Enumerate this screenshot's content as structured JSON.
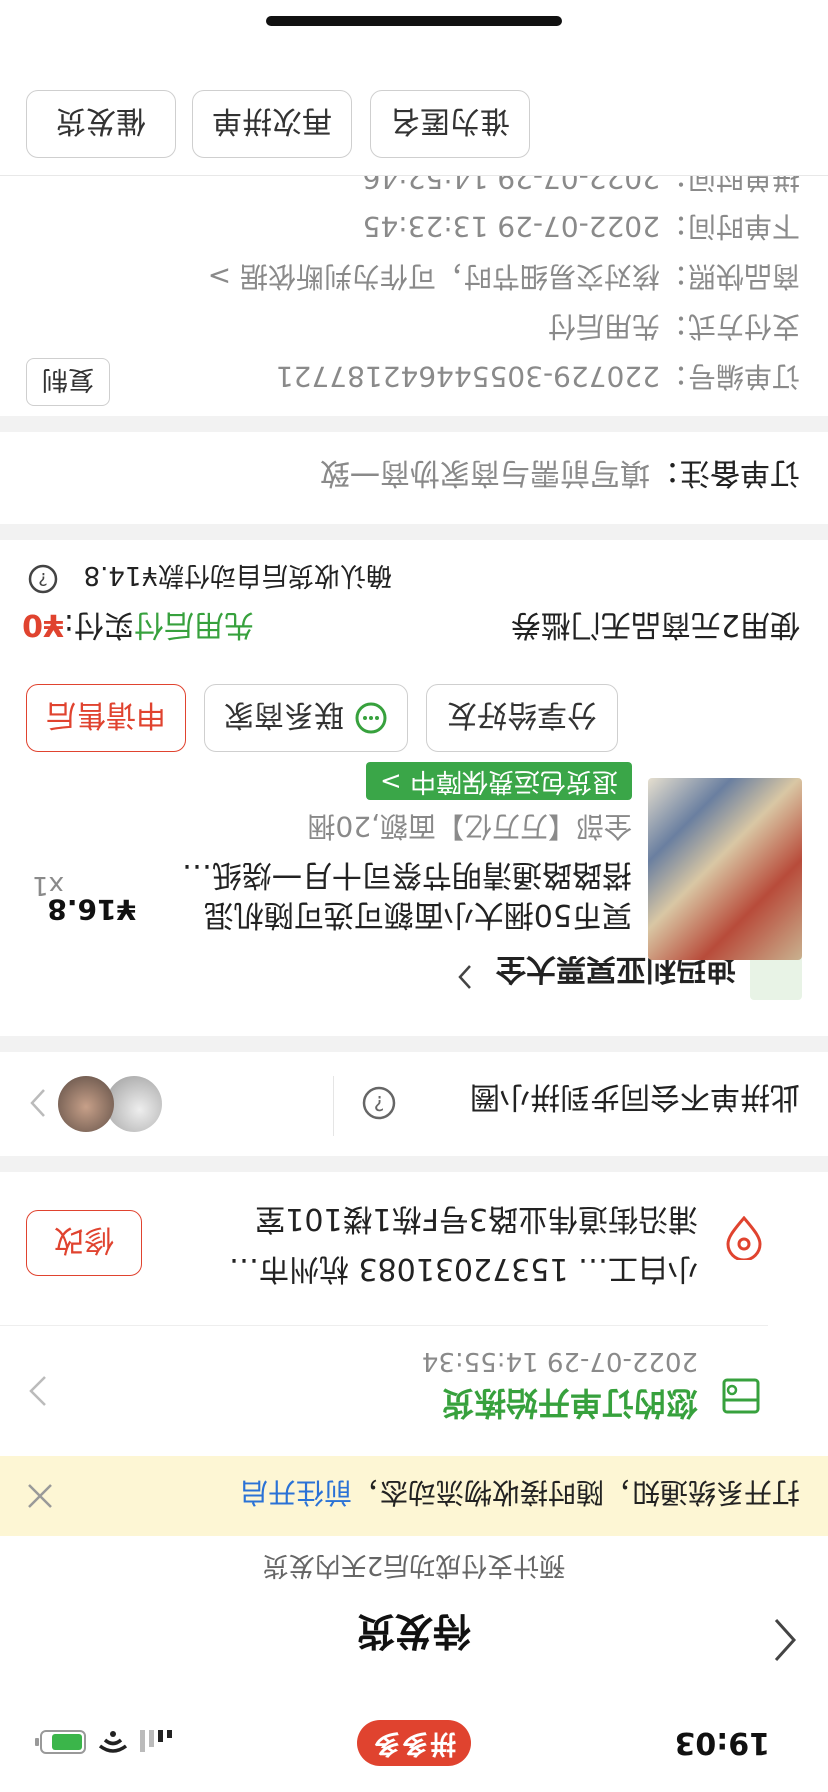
{
  "status_bar": {
    "time": "19:03",
    "brand": "拼多多"
  },
  "header": {
    "title": "待发货",
    "subtitle": "预计支付成功后2天内发货"
  },
  "notice": {
    "text": "打开系统通知，随时接收物流动态，",
    "link": "前往开启"
  },
  "logistics": {
    "status": "您的订单开始拣货",
    "time": "2022-07-29 14:55:34"
  },
  "address": {
    "line1": "小白工…    15372031083  杭州市…",
    "line2": "浦沿街道伟业路3号F栋1楼101室",
    "edit_label": "修改"
  },
  "group": {
    "text": "此拼单不会同步到拼小圈"
  },
  "shop": {
    "name": "迪玛利亚冥票大全",
    "logo_text": "迪玛利亚冥票大全"
  },
  "product": {
    "title": "冥币50捆大小面额可选可随机混搭路路通清明节祭司十月一烧纸…",
    "spec": "全部【万万亿】面额,20捆",
    "price": "¥16.8",
    "qty": "x1",
    "guarantee": "退货包运费保障中 >"
  },
  "actions": {
    "share": "分享给好友",
    "contact": "联系商家",
    "after_sale": "申请售后"
  },
  "payment": {
    "coupon_label": "使用2元商品无门槛券",
    "pay_later": "先用后付",
    "paid_label": "实付:",
    "paid_amount": "¥0",
    "note": "确认收货后自动付款¥14.8"
  },
  "remark": {
    "label": "订单备注：",
    "value": "填写前需与商家协商一致"
  },
  "order_info": {
    "rows": [
      {
        "label": "订单编号：",
        "value": "220729-305544642187721"
      },
      {
        "label": "支付方式：",
        "value": "先用后付"
      },
      {
        "label": "商品快照：",
        "value": "核对交易细节时，可作为判断依据 >"
      },
      {
        "label": "下单时间：",
        "value": "2022-07-29 13:23:45"
      },
      {
        "label": "拼单时间：",
        "value": "2022-07-29 14:52:46"
      }
    ],
    "copy_label": "复制"
  },
  "bottom_buttons": {
    "pay_for_me": "谁为匿名",
    "regroup": "再次拼单",
    "remind": "催发货"
  },
  "colors": {
    "accent": "#e0432f",
    "green": "#37a13d",
    "link": "#2a72d6",
    "notice_bg": "#fdf6d4"
  }
}
